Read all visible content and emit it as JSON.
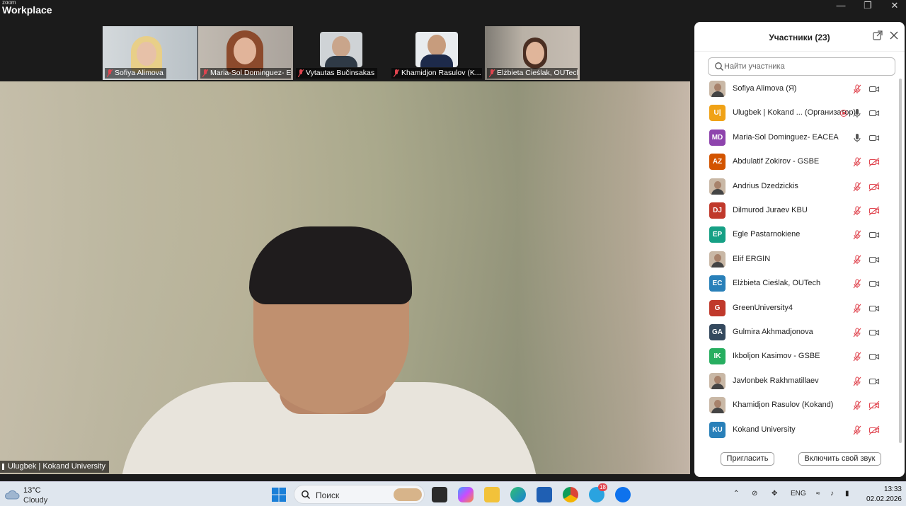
{
  "app": {
    "brand_small": "zoom",
    "brand_big": "Workplace"
  },
  "filmstrip": [
    {
      "name": "Sofiya Alimova",
      "bg": "#c7cdd0",
      "muted": true
    },
    {
      "name": "Maria-Sol Dominguez- EA...",
      "bg": "#b9b2ab",
      "muted": true
    },
    {
      "name": "Vytautas Bučinsakas",
      "bg": "#2a2a2a",
      "muted": true
    },
    {
      "name": "Khamidjon Rasulov (K...",
      "bg": "#2a2a2a",
      "muted": true
    },
    {
      "name": "Elżbieta Cieślak, OUTech",
      "bg": "#a9a39a",
      "muted": true
    }
  ],
  "main_video": {
    "speaker_label": "Ulugbek | Kokand University"
  },
  "panel": {
    "title": "Участники (23)",
    "search_placeholder": "Найти участника",
    "participants": [
      {
        "name": "Sofiya Alimova (Я)",
        "initials": "",
        "color": "#c9b8a6",
        "mic": "muted",
        "video": "on",
        "photo": true
      },
      {
        "name": "Ulugbek | Kokand ... (Организатор)",
        "initials": "U|",
        "color": "#f0a216",
        "mic": "on",
        "video": "on",
        "photo": false,
        "recording": true
      },
      {
        "name": "Maria-Sol Dominguez- EACEA",
        "initials": "MD",
        "color": "#8e44ad",
        "mic": "on",
        "video": "on",
        "photo": false
      },
      {
        "name": "Abdulatif Zokirov - GSBE",
        "initials": "AZ",
        "color": "#d35400",
        "mic": "muted",
        "video": "off",
        "photo": false
      },
      {
        "name": "Andrius Dzedzickis",
        "initials": "",
        "color": "#c9b8a6",
        "mic": "muted",
        "video": "off",
        "photo": true
      },
      {
        "name": "Dilmurod Juraev KBU",
        "initials": "DJ",
        "color": "#c0392b",
        "mic": "muted",
        "video": "off",
        "photo": false
      },
      {
        "name": "Egle Pastarnokiene",
        "initials": "EP",
        "color": "#16a085",
        "mic": "muted",
        "video": "on",
        "photo": false
      },
      {
        "name": "Elif ERGİN",
        "initials": "",
        "color": "#c9b8a6",
        "mic": "muted",
        "video": "on",
        "photo": true
      },
      {
        "name": "Elżbieta Cieślak, OUTech",
        "initials": "EC",
        "color": "#2980b9",
        "mic": "muted",
        "video": "on",
        "photo": false
      },
      {
        "name": "GreenUniversity4",
        "initials": "G",
        "color": "#c0392b",
        "mic": "muted",
        "video": "on",
        "photo": false
      },
      {
        "name": "Gulmira Akhmadjonova",
        "initials": "GA",
        "color": "#34495e",
        "mic": "muted",
        "video": "on",
        "photo": false
      },
      {
        "name": "Ikboljon Kasimov - GSBE",
        "initials": "IK",
        "color": "#27ae60",
        "mic": "muted",
        "video": "on",
        "photo": false
      },
      {
        "name": "Javlonbek Rakhmatillaev",
        "initials": "",
        "color": "#c9b8a6",
        "mic": "muted",
        "video": "on",
        "photo": true
      },
      {
        "name": "Khamidjon Rasulov (Kokand)",
        "initials": "",
        "color": "#c9b8a6",
        "mic": "muted",
        "video": "off",
        "photo": true
      },
      {
        "name": "Kokand University",
        "initials": "KU",
        "color": "#2980b9",
        "mic": "muted",
        "video": "off",
        "photo": false
      }
    ],
    "invite_label": "Пригласить",
    "unmute_label": "Включить свой звук"
  },
  "taskbar": {
    "temperature": "13°C",
    "condition": "Cloudy",
    "search_label": "Поиск",
    "language": "ENG",
    "time": "13:33",
    "date": "02.02.2026",
    "telegram_badge": "18"
  },
  "colors": {
    "muted_red": "#e0454f",
    "accent_blue": "#0e72ed"
  }
}
